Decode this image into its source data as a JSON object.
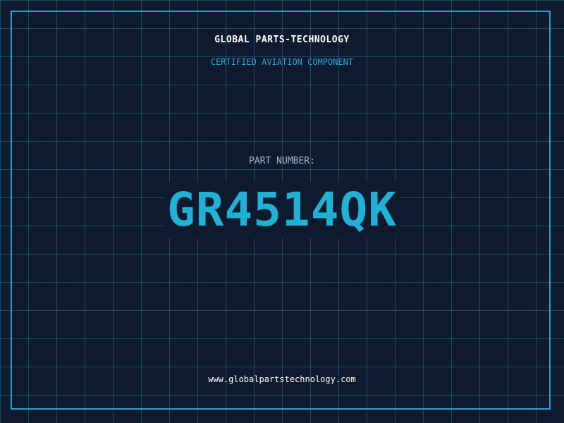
{
  "header": {
    "company": "GLOBAL PARTS-TECHNOLOGY",
    "tagline": "CERTIFIED AVIATION COMPONENT"
  },
  "part": {
    "label": "PART NUMBER:",
    "number": "GR4514QK"
  },
  "footer": {
    "url": "www.globalpartstechnology.com"
  },
  "colors": {
    "background": "#0f1a2e",
    "grid": "#1f8caa",
    "frame": "#1fa8cc",
    "accent": "#1fb2d6",
    "tagline": "#2aa8d8",
    "label": "#aab4c4"
  }
}
